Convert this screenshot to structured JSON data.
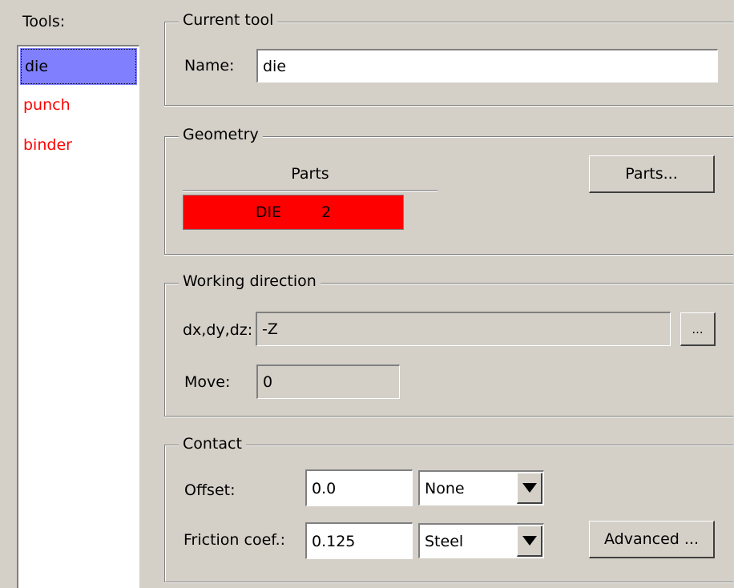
{
  "tools": {
    "label": "Tools:",
    "items": [
      {
        "name": "die"
      },
      {
        "name": "punch"
      },
      {
        "name": "binder"
      }
    ]
  },
  "current_tool": {
    "title": "Current tool",
    "name_label": "Name:",
    "name_value": "die"
  },
  "geometry": {
    "title": "Geometry",
    "parts_header": "Parts",
    "parts_button": "Parts...",
    "rows": [
      {
        "part": "DIE",
        "id": "2"
      }
    ]
  },
  "working_direction": {
    "title": "Working direction",
    "dir_label": "dx,dy,dz:",
    "dir_value": "-Z",
    "dir_button": "...",
    "move_label": "Move:",
    "move_value": "0"
  },
  "contact": {
    "title": "Contact",
    "offset_label": "Offset:",
    "offset_value": "0.0",
    "offset_select": "None",
    "friction_label": "Friction coef.:",
    "friction_value": "0.125",
    "friction_select": "Steel",
    "advanced_button": "Advanced ..."
  },
  "colors": {
    "background": "#d4d0c8",
    "selected": "#8080ff",
    "inactive_tool": "#ff0000",
    "part_row": "#ff0000"
  }
}
